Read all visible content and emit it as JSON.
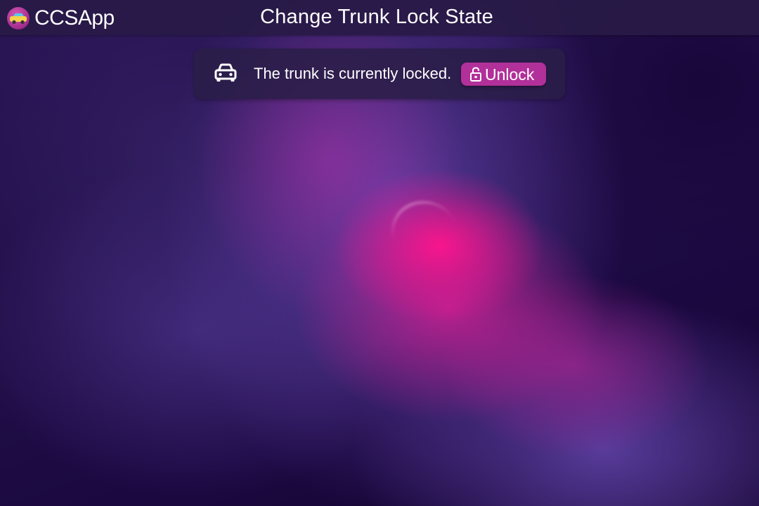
{
  "header": {
    "app_name": "CCSApp",
    "app_icon": "car-icon",
    "page_title": "Change Trunk Lock State"
  },
  "status_card": {
    "icon": "car-icon",
    "message": "The trunk is currently locked.",
    "button": {
      "icon": "unlock-icon",
      "label": "Unlock"
    }
  },
  "colors": {
    "accent": "#b2309a",
    "topbar": "#281a46",
    "card": "#2a1e48"
  }
}
